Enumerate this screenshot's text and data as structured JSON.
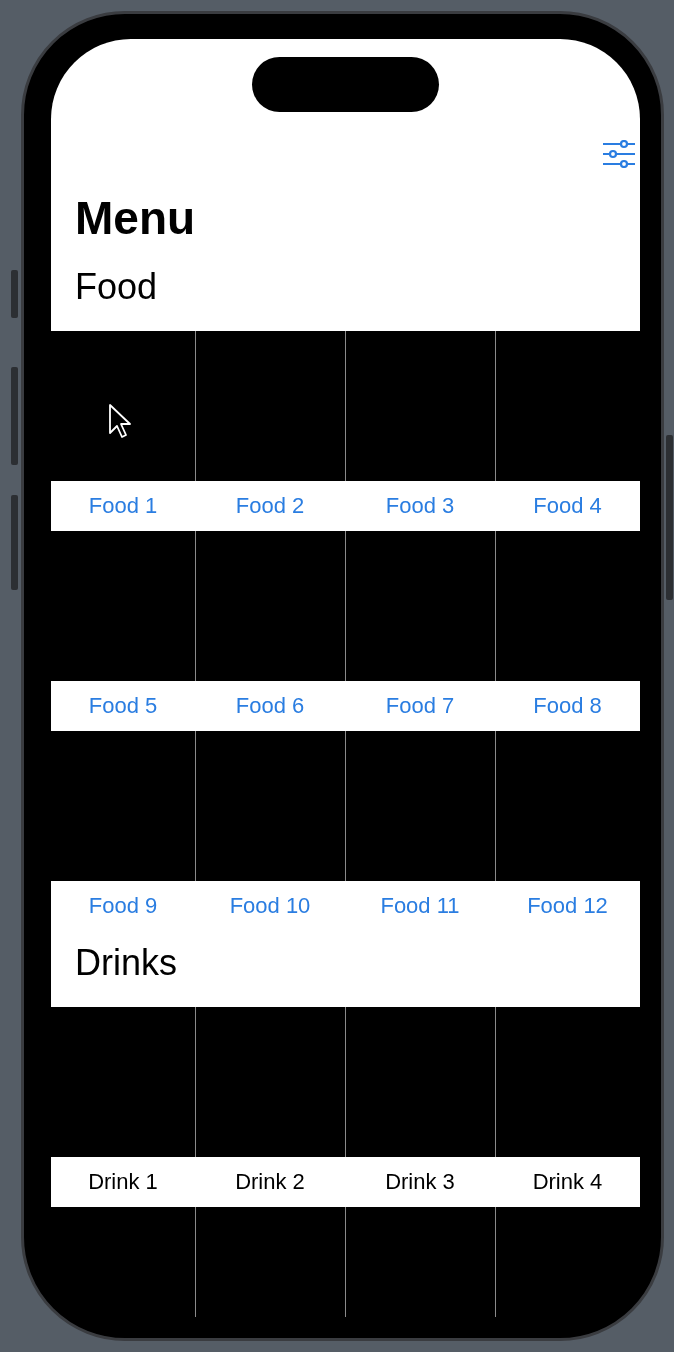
{
  "title": "Menu",
  "sections": [
    {
      "heading": "Food",
      "kind": "food",
      "items": [
        "Food 1",
        "Food 2",
        "Food 3",
        "Food 4",
        "Food 5",
        "Food 6",
        "Food 7",
        "Food 8",
        "Food 9",
        "Food 10",
        "Food 11",
        "Food 12"
      ]
    },
    {
      "heading": "Drinks",
      "kind": "drink",
      "items": [
        "Drink 1",
        "Drink 2",
        "Drink 3",
        "Drink 4"
      ]
    }
  ]
}
